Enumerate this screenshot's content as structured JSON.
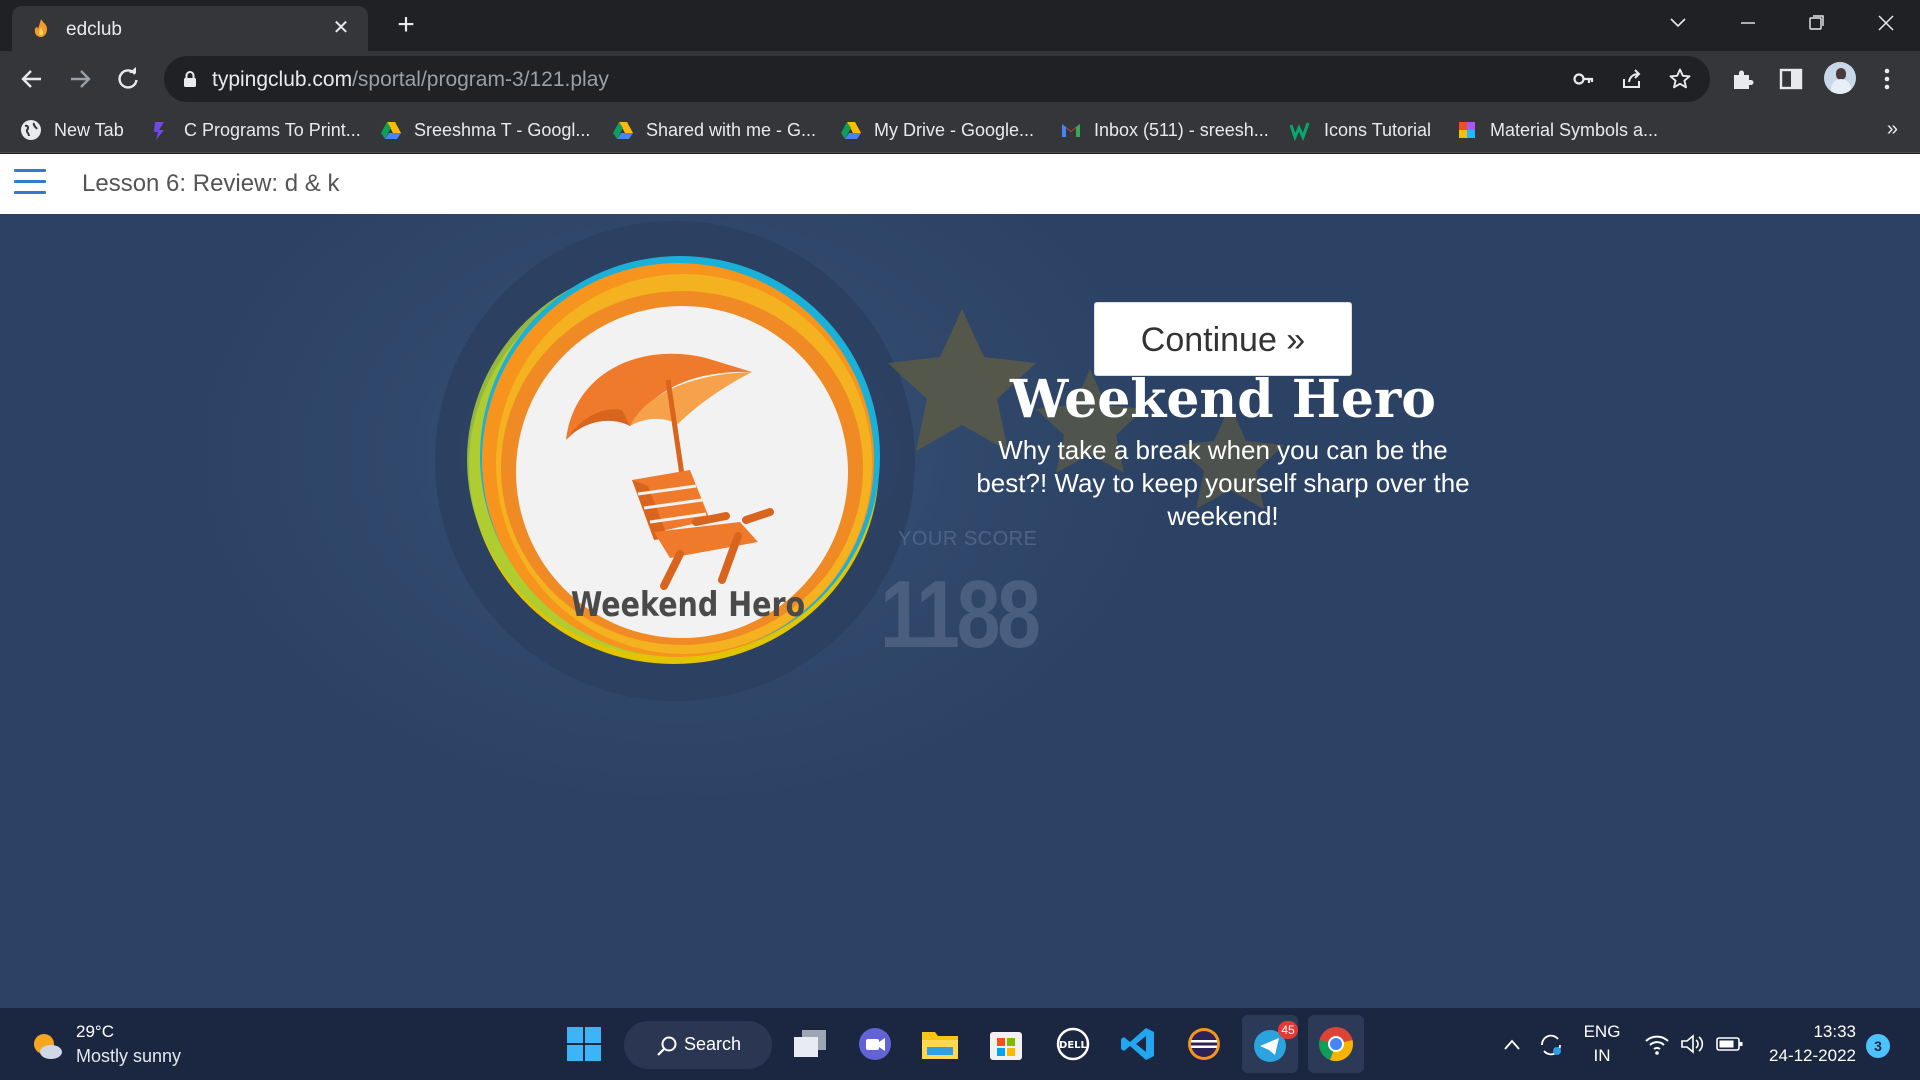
{
  "browser": {
    "tab": {
      "title": "edclub",
      "close": "✕"
    },
    "new_tab": "+",
    "window_controls": {
      "dropdown": "⌵",
      "minimize": "—",
      "restore": "❐",
      "close": "✕"
    },
    "url": {
      "domain": "typingclub.com",
      "path": "/sportal/program-3/121.play"
    },
    "bookmarks": [
      {
        "label": "New Tab",
        "icon": "globe-icon"
      },
      {
        "label": "C Programs To Print...",
        "icon": "bookmark-p-icon"
      },
      {
        "label": "Sreeshma T - Googl...",
        "icon": "drive-icon"
      },
      {
        "label": "Shared with me - G...",
        "icon": "drive-icon"
      },
      {
        "label": "My Drive - Google...",
        "icon": "drive-icon"
      },
      {
        "label": "Inbox (511) - sreesh...",
        "icon": "gmail-icon"
      },
      {
        "label": "Icons Tutorial",
        "icon": "w3-icon"
      },
      {
        "label": "Material Symbols a...",
        "icon": "figma-icon"
      }
    ],
    "bookmarks_more": "»"
  },
  "page": {
    "lesson_title": "Lesson 6: Review: d & k",
    "badge_text": "Weekend Hero",
    "score_label": "YOUR SCORE",
    "score_value": "1188",
    "continue_label": "Continue »",
    "hero_title": "Weekend Hero",
    "hero_description": "Why take a break when you can be the best?! Way to keep yourself sharp over the weekend!"
  },
  "taskbar": {
    "weather_temp": "29°C",
    "weather_desc": "Mostly sunny",
    "search_label": "Search",
    "telegram_badge": "45",
    "lang_top": "ENG",
    "lang_bottom": "IN",
    "time": "13:33",
    "date": "24-12-2022",
    "notification_count": "3"
  },
  "colors": {
    "stage_bg": "#2d4366",
    "badge_orange": "#f07a2c",
    "link_blue": "#2e7bd1"
  }
}
